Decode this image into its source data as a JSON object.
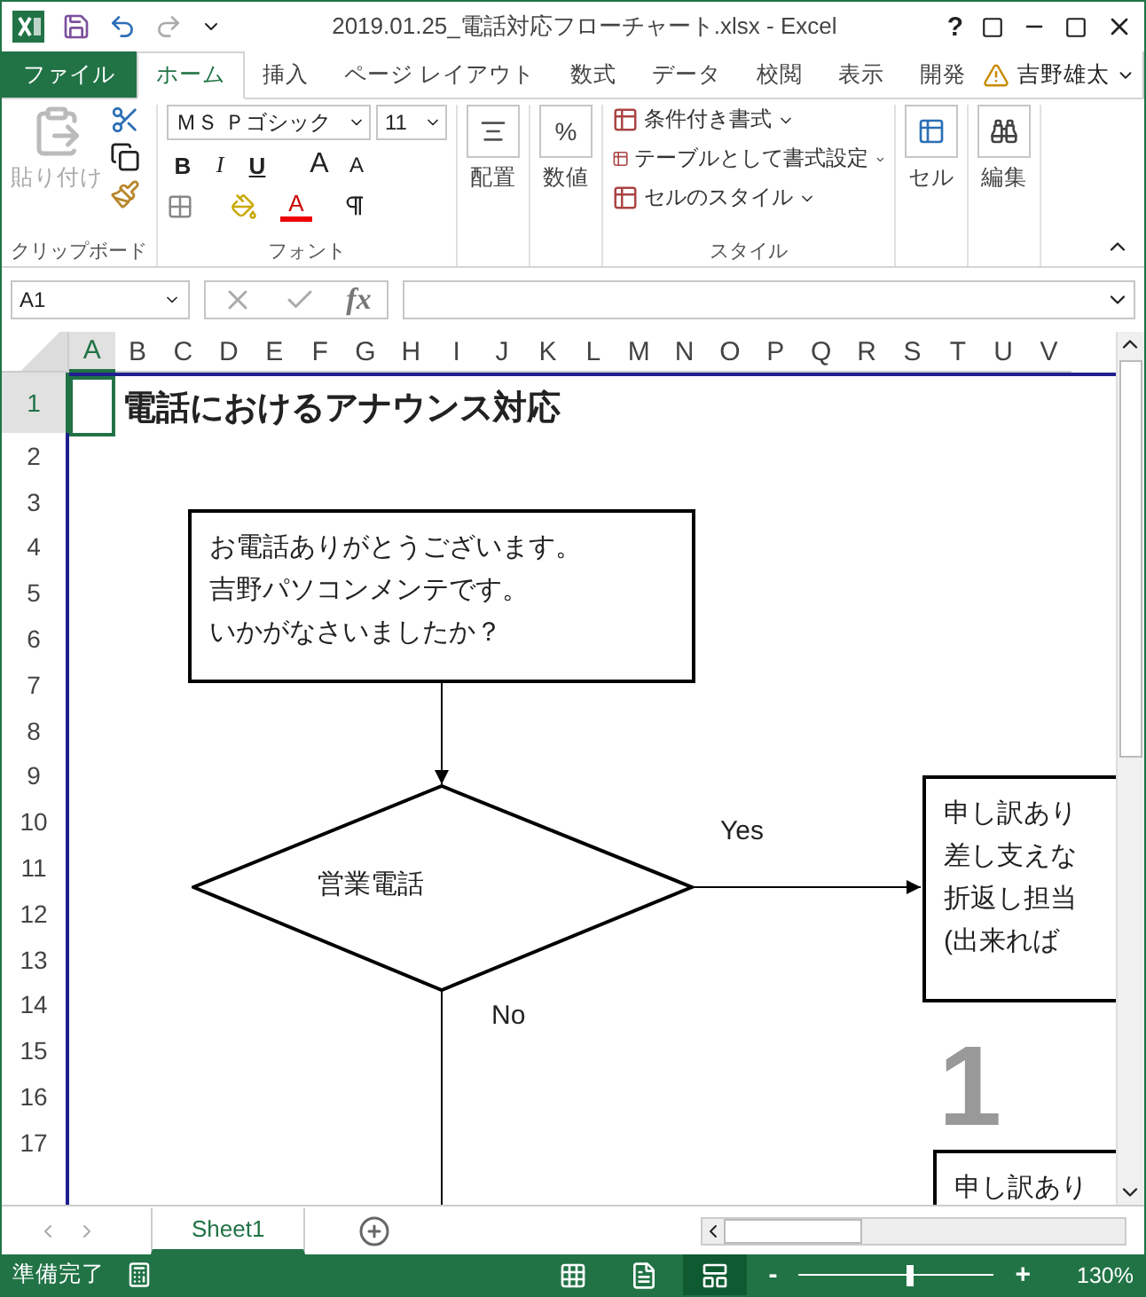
{
  "title_bar": {
    "title": "2019.01.25_電話対応フローチャート.xlsx - Excel",
    "help": "?"
  },
  "ribbon_tabs": [
    {
      "label": "ファイル",
      "kind": "file",
      "selected": false
    },
    {
      "label": "ホーム",
      "kind": "tab",
      "selected": true
    },
    {
      "label": "挿入",
      "kind": "tab",
      "selected": false
    },
    {
      "label": "ページ レイアウト",
      "kind": "tab",
      "selected": false
    },
    {
      "label": "数式",
      "kind": "tab",
      "selected": false
    },
    {
      "label": "データ",
      "kind": "tab",
      "selected": false
    },
    {
      "label": "校閲",
      "kind": "tab",
      "selected": false
    },
    {
      "label": "表示",
      "kind": "tab",
      "selected": false
    },
    {
      "label": "開発",
      "kind": "tab",
      "selected": false
    }
  ],
  "user": {
    "name": "吉野雄太"
  },
  "ribbon": {
    "clipboard": {
      "paste": "貼り付け",
      "label": "クリップボード"
    },
    "font": {
      "name": "ＭＳ Ｐゴシック",
      "size": "11",
      "bold": "B",
      "italic": "I",
      "underline": "U",
      "grow": "A",
      "shrink": "A",
      "font_color_letter": "A",
      "label": "フォント"
    },
    "alignment": "配置",
    "number": {
      "symbol": "%",
      "label": "数値"
    },
    "styles": {
      "items": [
        "条件付き書式",
        "テーブルとして書式設定",
        "セルのスタイル"
      ],
      "label": "スタイル"
    },
    "cells": "セル",
    "editing": "編集"
  },
  "formula_bar": {
    "name_box": "A1",
    "function": "fx"
  },
  "columns": [
    {
      "label": "A",
      "selected": true
    },
    {
      "label": "B",
      "selected": false
    },
    {
      "label": "C",
      "selected": false
    },
    {
      "label": "D",
      "selected": false
    },
    {
      "label": "E",
      "selected": false
    },
    {
      "label": "F",
      "selected": false
    },
    {
      "label": "G",
      "selected": false
    },
    {
      "label": "H",
      "selected": false
    },
    {
      "label": "I",
      "selected": false
    },
    {
      "label": "J",
      "selected": false
    },
    {
      "label": "K",
      "selected": false
    },
    {
      "label": "L",
      "selected": false
    },
    {
      "label": "M",
      "selected": false
    },
    {
      "label": "N",
      "selected": false
    },
    {
      "label": "O",
      "selected": false
    },
    {
      "label": "P",
      "selected": false
    },
    {
      "label": "Q",
      "selected": false
    },
    {
      "label": "R",
      "selected": false
    },
    {
      "label": "S",
      "selected": false
    },
    {
      "label": "T",
      "selected": false
    },
    {
      "label": "U",
      "selected": false
    },
    {
      "label": "V",
      "selected": false
    }
  ],
  "rows": [
    {
      "label": "1",
      "selected": true
    },
    {
      "label": "2",
      "selected": false
    },
    {
      "label": "3",
      "selected": false
    },
    {
      "label": "4",
      "selected": false
    },
    {
      "label": "5",
      "selected": false
    },
    {
      "label": "6",
      "selected": false
    },
    {
      "label": "7",
      "selected": false
    },
    {
      "label": "8",
      "selected": false
    },
    {
      "label": "9",
      "selected": false
    },
    {
      "label": "10",
      "selected": false
    },
    {
      "label": "11",
      "selected": false
    },
    {
      "label": "12",
      "selected": false
    },
    {
      "label": "13",
      "selected": false
    },
    {
      "label": "14",
      "selected": false
    },
    {
      "label": "15",
      "selected": false
    },
    {
      "label": "16",
      "selected": false
    },
    {
      "label": "17",
      "selected": false
    }
  ],
  "sheet_title": "電話におけるアナウンス対応",
  "page_number": "1",
  "flowchart": {
    "nodes": [
      {
        "kind": "process",
        "lines": [
          "お電話ありがとうございます。",
          "吉野パソコンメンテです。",
          "いかがなさいましたか？"
        ]
      },
      {
        "kind": "decision",
        "lines": [
          "営業電話"
        ]
      },
      {
        "kind": "process",
        "lines": [
          "申し訳あり",
          "差し支えな",
          "折返し担当",
          "(出来れば"
        ]
      },
      {
        "kind": "process",
        "lines": [
          "申し訳あり"
        ]
      }
    ],
    "edge_labels": [
      "Yes",
      "No"
    ]
  },
  "sheet_tabs": [
    {
      "label": "Sheet1",
      "selected": true
    }
  ],
  "status_bar": {
    "status": "準備完了",
    "view_modes": [
      {
        "kind": "normal",
        "selected": false
      },
      {
        "kind": "layout",
        "selected": false
      },
      {
        "kind": "break",
        "selected": true
      }
    ],
    "zoom": {
      "minus": "-",
      "plus": "+",
      "level": 0.55,
      "reading": "130%"
    }
  }
}
